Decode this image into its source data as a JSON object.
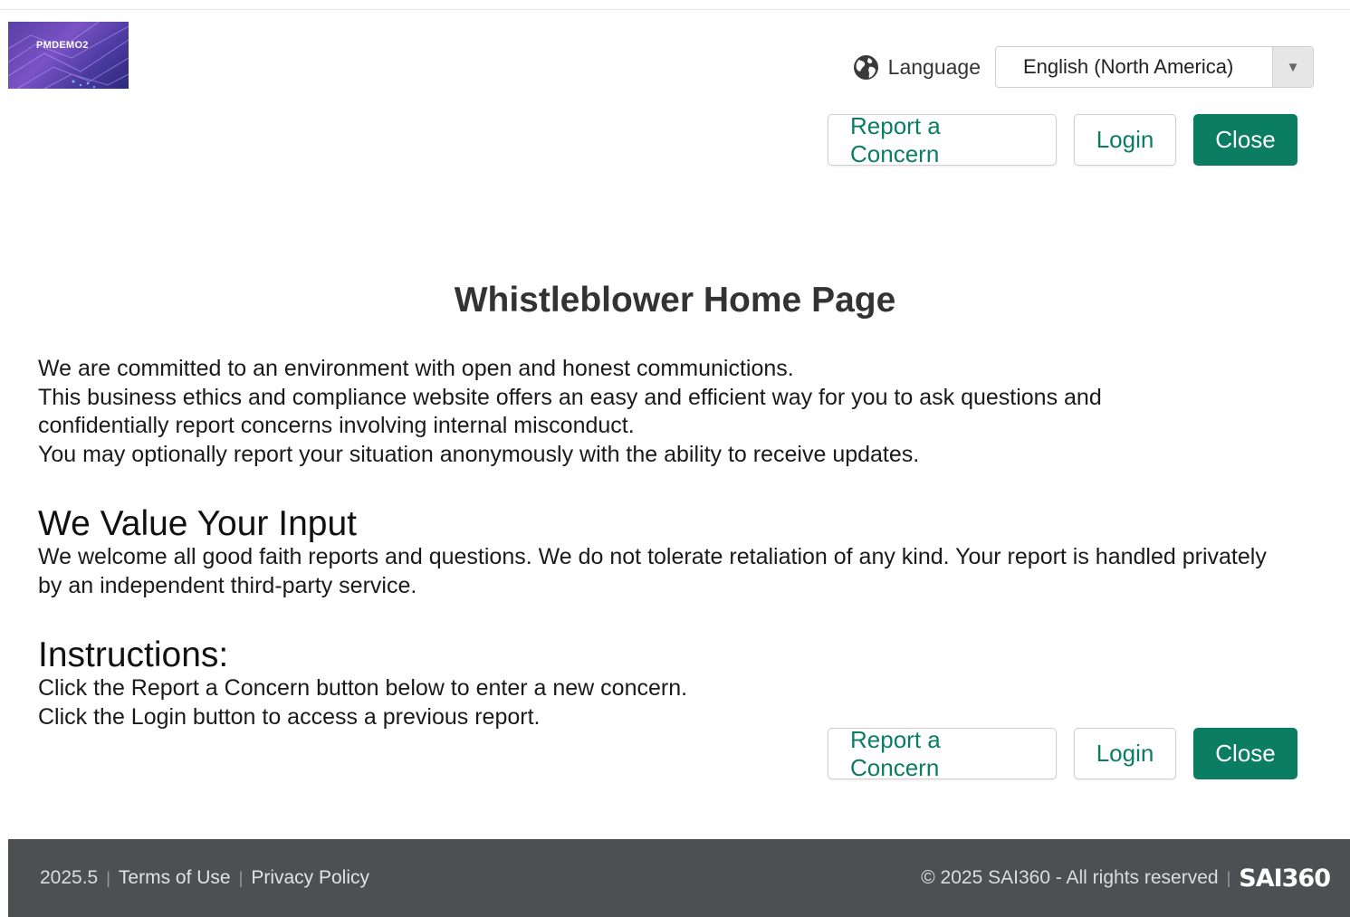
{
  "header": {
    "logo_text": "PMDEMO2",
    "language_label": "Language",
    "language_value": "English (North America)",
    "language_caret": "▼"
  },
  "actions": {
    "report_label": "Report a Concern",
    "login_label": "Login",
    "close_label": "Close"
  },
  "main": {
    "title": "Whistleblower Home Page",
    "intro": [
      "We are committed to an environment with open and honest communictions.",
      "This business ethics and compliance website offers an easy and efficient way for you to ask questions and confidentially report concerns involving internal misconduct.",
      "You may optionally report your situation anonymously with the ability to receive updates."
    ],
    "value_heading": "We Value Your Input",
    "value_text": "We welcome all good faith reports and questions.  We do not tolerate retaliation of any kind. Your report is handled privately by an independent third-party service.",
    "instructions_heading": "Instructions:",
    "instructions": [
      "Click the Report a Concern button below to enter a new concern.",
      "Click the Login button to access a previous report."
    ]
  },
  "footer": {
    "version": "2025.5",
    "separator": "|",
    "terms": "Terms of Use",
    "privacy": "Privacy Policy",
    "copyright": "© 2025 SAI360 - All rights reserved",
    "brand": "SAI360"
  },
  "colors": {
    "accent": "#0a7d63",
    "footer_bg": "#4d4f53"
  },
  "icons": {
    "globe": "globe-icon"
  }
}
